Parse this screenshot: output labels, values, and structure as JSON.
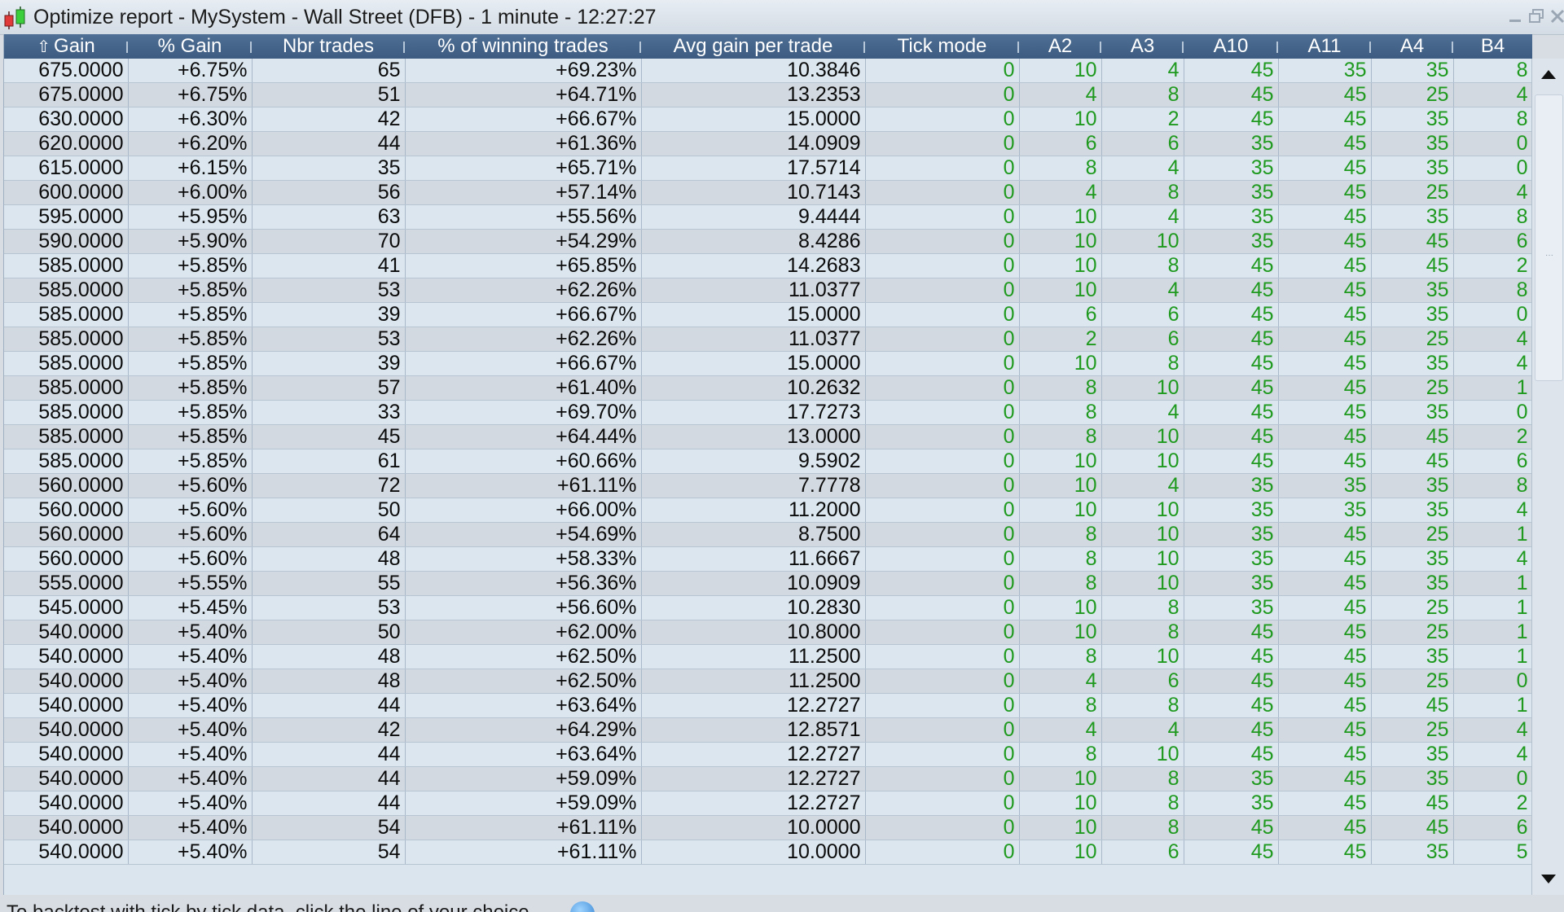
{
  "window": {
    "title": "Optimize report - MySystem - Wall Street (DFB) - 1 minute - 12:27:27",
    "icon": "candlestick-chart-icon"
  },
  "columns": [
    {
      "label": "Gain",
      "sorted": "ascending",
      "sort_icon": "sort-up-arrow-icon"
    },
    {
      "label": "% Gain"
    },
    {
      "label": "Nbr trades"
    },
    {
      "label": "% of winning trades"
    },
    {
      "label": "Avg gain per trade"
    },
    {
      "label": "Tick mode"
    },
    {
      "label": "A2"
    },
    {
      "label": "A3"
    },
    {
      "label": "A10"
    },
    {
      "label": "A11"
    },
    {
      "label": "A4"
    },
    {
      "label": "B4"
    }
  ],
  "colors": {
    "header_bg": "#46668c",
    "row_odd": "#dbe6ef",
    "row_even": "#d3d9e0",
    "parameter_text": "#1f9a1f",
    "stat_text": "#0b0b0b"
  },
  "rows": [
    [
      "675.0000",
      "+6.75%",
      "65",
      "+69.23%",
      "10.3846",
      "0",
      "10",
      "4",
      "45",
      "35",
      "35",
      "8"
    ],
    [
      "675.0000",
      "+6.75%",
      "51",
      "+64.71%",
      "13.2353",
      "0",
      "4",
      "8",
      "45",
      "45",
      "25",
      "4"
    ],
    [
      "630.0000",
      "+6.30%",
      "42",
      "+66.67%",
      "15.0000",
      "0",
      "10",
      "2",
      "45",
      "45",
      "35",
      "8"
    ],
    [
      "620.0000",
      "+6.20%",
      "44",
      "+61.36%",
      "14.0909",
      "0",
      "6",
      "6",
      "35",
      "45",
      "35",
      "0"
    ],
    [
      "615.0000",
      "+6.15%",
      "35",
      "+65.71%",
      "17.5714",
      "0",
      "8",
      "4",
      "35",
      "45",
      "35",
      "0"
    ],
    [
      "600.0000",
      "+6.00%",
      "56",
      "+57.14%",
      "10.7143",
      "0",
      "4",
      "8",
      "35",
      "45",
      "25",
      "4"
    ],
    [
      "595.0000",
      "+5.95%",
      "63",
      "+55.56%",
      "9.4444",
      "0",
      "10",
      "4",
      "35",
      "45",
      "35",
      "8"
    ],
    [
      "590.0000",
      "+5.90%",
      "70",
      "+54.29%",
      "8.4286",
      "0",
      "10",
      "10",
      "35",
      "45",
      "45",
      "6"
    ],
    [
      "585.0000",
      "+5.85%",
      "41",
      "+65.85%",
      "14.2683",
      "0",
      "10",
      "8",
      "45",
      "45",
      "45",
      "2"
    ],
    [
      "585.0000",
      "+5.85%",
      "53",
      "+62.26%",
      "11.0377",
      "0",
      "10",
      "4",
      "45",
      "45",
      "35",
      "8"
    ],
    [
      "585.0000",
      "+5.85%",
      "39",
      "+66.67%",
      "15.0000",
      "0",
      "6",
      "6",
      "45",
      "45",
      "35",
      "0"
    ],
    [
      "585.0000",
      "+5.85%",
      "53",
      "+62.26%",
      "11.0377",
      "0",
      "2",
      "6",
      "45",
      "45",
      "25",
      "4"
    ],
    [
      "585.0000",
      "+5.85%",
      "39",
      "+66.67%",
      "15.0000",
      "0",
      "10",
      "8",
      "45",
      "45",
      "35",
      "4"
    ],
    [
      "585.0000",
      "+5.85%",
      "57",
      "+61.40%",
      "10.2632",
      "0",
      "8",
      "10",
      "45",
      "45",
      "25",
      "1"
    ],
    [
      "585.0000",
      "+5.85%",
      "33",
      "+69.70%",
      "17.7273",
      "0",
      "8",
      "4",
      "45",
      "45",
      "35",
      "0"
    ],
    [
      "585.0000",
      "+5.85%",
      "45",
      "+64.44%",
      "13.0000",
      "0",
      "8",
      "10",
      "45",
      "45",
      "45",
      "2"
    ],
    [
      "585.0000",
      "+5.85%",
      "61",
      "+60.66%",
      "9.5902",
      "0",
      "10",
      "10",
      "45",
      "45",
      "45",
      "6"
    ],
    [
      "560.0000",
      "+5.60%",
      "72",
      "+61.11%",
      "7.7778",
      "0",
      "10",
      "4",
      "35",
      "35",
      "35",
      "8"
    ],
    [
      "560.0000",
      "+5.60%",
      "50",
      "+66.00%",
      "11.2000",
      "0",
      "10",
      "10",
      "35",
      "35",
      "35",
      "4"
    ],
    [
      "560.0000",
      "+5.60%",
      "64",
      "+54.69%",
      "8.7500",
      "0",
      "8",
      "10",
      "35",
      "45",
      "25",
      "1"
    ],
    [
      "560.0000",
      "+5.60%",
      "48",
      "+58.33%",
      "11.6667",
      "0",
      "8",
      "10",
      "35",
      "45",
      "35",
      "4"
    ],
    [
      "555.0000",
      "+5.55%",
      "55",
      "+56.36%",
      "10.0909",
      "0",
      "8",
      "10",
      "35",
      "45",
      "35",
      "1"
    ],
    [
      "545.0000",
      "+5.45%",
      "53",
      "+56.60%",
      "10.2830",
      "0",
      "10",
      "8",
      "35",
      "45",
      "25",
      "1"
    ],
    [
      "540.0000",
      "+5.40%",
      "50",
      "+62.00%",
      "10.8000",
      "0",
      "10",
      "8",
      "45",
      "45",
      "25",
      "1"
    ],
    [
      "540.0000",
      "+5.40%",
      "48",
      "+62.50%",
      "11.2500",
      "0",
      "8",
      "10",
      "45",
      "45",
      "35",
      "1"
    ],
    [
      "540.0000",
      "+5.40%",
      "48",
      "+62.50%",
      "11.2500",
      "0",
      "4",
      "6",
      "45",
      "45",
      "25",
      "0"
    ],
    [
      "540.0000",
      "+5.40%",
      "44",
      "+63.64%",
      "12.2727",
      "0",
      "8",
      "8",
      "45",
      "45",
      "45",
      "1"
    ],
    [
      "540.0000",
      "+5.40%",
      "42",
      "+64.29%",
      "12.8571",
      "0",
      "4",
      "4",
      "45",
      "45",
      "25",
      "4"
    ],
    [
      "540.0000",
      "+5.40%",
      "44",
      "+63.64%",
      "12.2727",
      "0",
      "8",
      "10",
      "45",
      "45",
      "35",
      "4"
    ],
    [
      "540.0000",
      "+5.40%",
      "44",
      "+59.09%",
      "12.2727",
      "0",
      "10",
      "8",
      "35",
      "45",
      "35",
      "0"
    ],
    [
      "540.0000",
      "+5.40%",
      "44",
      "+59.09%",
      "12.2727",
      "0",
      "10",
      "8",
      "35",
      "45",
      "45",
      "2"
    ],
    [
      "540.0000",
      "+5.40%",
      "54",
      "+61.11%",
      "10.0000",
      "0",
      "10",
      "8",
      "45",
      "45",
      "45",
      "6"
    ],
    [
      "540.0000",
      "+5.40%",
      "54",
      "+61.11%",
      "10.0000",
      "0",
      "10",
      "6",
      "45",
      "45",
      "35",
      "5"
    ]
  ],
  "status": {
    "text": "To backtest with tick by tick data, click the line of your choice",
    "icon": "info-bubble-icon"
  }
}
